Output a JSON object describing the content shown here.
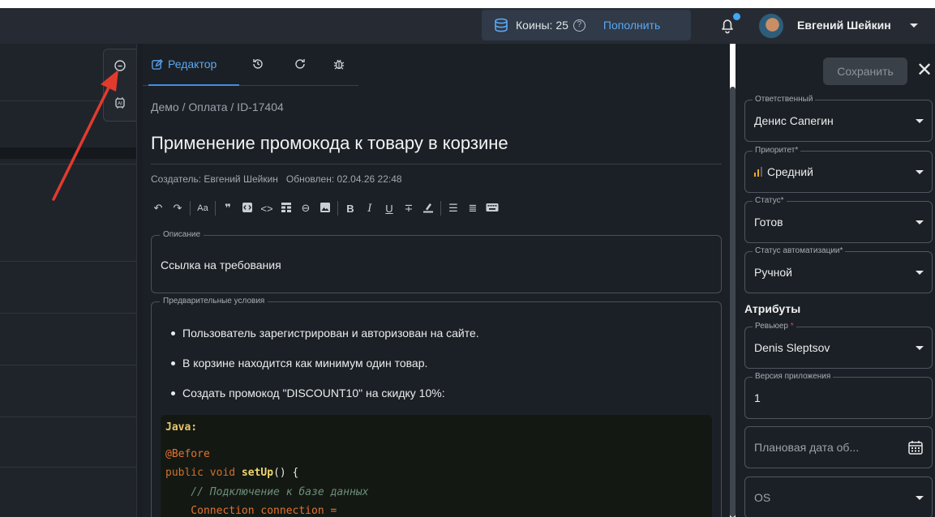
{
  "header": {
    "coins_label": "Коины: 25",
    "help_glyph": "?",
    "topup_label": "Пополнить",
    "username": "Евгений Шейкин"
  },
  "tabs": {
    "editor_label": "Редактор"
  },
  "doc": {
    "breadcrumb": "Демо / Оплата / ID-17404",
    "title": "Применение промокода к товару в корзине",
    "meta": "Создатель: Евгений Шейкин   Обновлен: 02.04.26 22:48",
    "description_legend": "Описание",
    "description_text": "Ссылка на требования",
    "preconditions_legend": "Предварительные условия",
    "preconditions": [
      "Пользователь зарегистрирован и авторизован на сайте.",
      "В корзине находится как минимум один товар.",
      "Создать промокод \"DISCOUNT10\" на скидку 10%:"
    ],
    "code": {
      "lang": "Java:",
      "annotation": "@Before",
      "kw": "public void ",
      "fn": "setUp",
      "rest": "() {",
      "comment": "    // Подключение к базе данных",
      "partial": "    Connection connection ="
    }
  },
  "sidebar": {
    "save_label": "Сохранить",
    "close_glyph": "✕",
    "fields": {
      "responsible": {
        "legend": "Ответственный",
        "value": "Денис Сапегин"
      },
      "priority": {
        "legend": "Приоритет*",
        "value": "Средний"
      },
      "status": {
        "legend": "Статус*",
        "value": "Готов"
      },
      "automation": {
        "legend": "Статус автоматизации*",
        "value": "Ручной"
      }
    },
    "attributes_title": "Атрибуты",
    "attrs": {
      "reviewer": {
        "legend": "Ревьюер",
        "required_mark": "*",
        "value": "Denis Sleptsov"
      },
      "app_version": {
        "legend": "Версия приложения",
        "value": "1"
      },
      "planned_date": {
        "placeholder": "Плановая дата об..."
      },
      "os": {
        "placeholder": "OS"
      }
    }
  },
  "toolbar_icons": [
    "undo-icon",
    "redo-icon",
    "font-size-icon",
    "quote-icon",
    "code-block-icon",
    "inline-code-icon",
    "table-icon",
    "link-icon",
    "image-icon",
    "bold-icon",
    "italic-icon",
    "underline-icon",
    "strikethrough-icon",
    "highlight-icon",
    "bullet-list-icon",
    "numbered-list-icon",
    "keyboard-icon"
  ],
  "colors": {
    "accent": "#5aa7f2",
    "annotation_arrow": "#e23b2e",
    "priority_medium": "#f5a623"
  }
}
